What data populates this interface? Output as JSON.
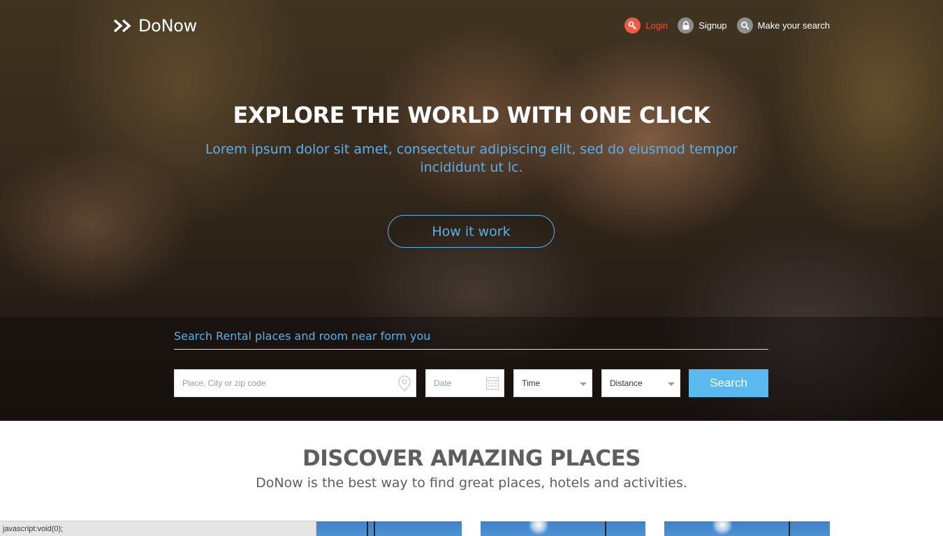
{
  "header": {
    "logo_text": "DoNow",
    "nav": {
      "login": "Login",
      "signup": "Signup",
      "search": "Make your search"
    }
  },
  "hero": {
    "title": "EXPLORE THE WORLD WITH ONE CLICK",
    "subtitle": "Lorem ipsum dolor sit amet, consectetur adipiscing elit, sed do eiusmod tempor incididunt ut lc.",
    "cta": "How it work"
  },
  "search": {
    "heading": "Search Rental places and room near form you",
    "place_placeholder": "Place, City or zip code",
    "date_placeholder": "Date",
    "time_value": "Time",
    "distance_value": "Distance",
    "button": "Search"
  },
  "discover": {
    "title": "DISCOVER AMAZING PLACES",
    "subtitle": "DoNow is the best way to find great places, hotels and activities."
  },
  "status_bar": {
    "text": "javascript:void(0);"
  },
  "colors": {
    "accent_blue": "#5ab0e9",
    "login_red": "#ee5b45",
    "search_button": "#5ab9ee",
    "heading_gray": "#5e5e5e"
  },
  "icons": {
    "logo": "double-chevron-icon",
    "login": "key-icon",
    "signup": "lock-icon",
    "search": "search-icon",
    "place": "map-pin-icon",
    "date": "calendar-icon"
  }
}
